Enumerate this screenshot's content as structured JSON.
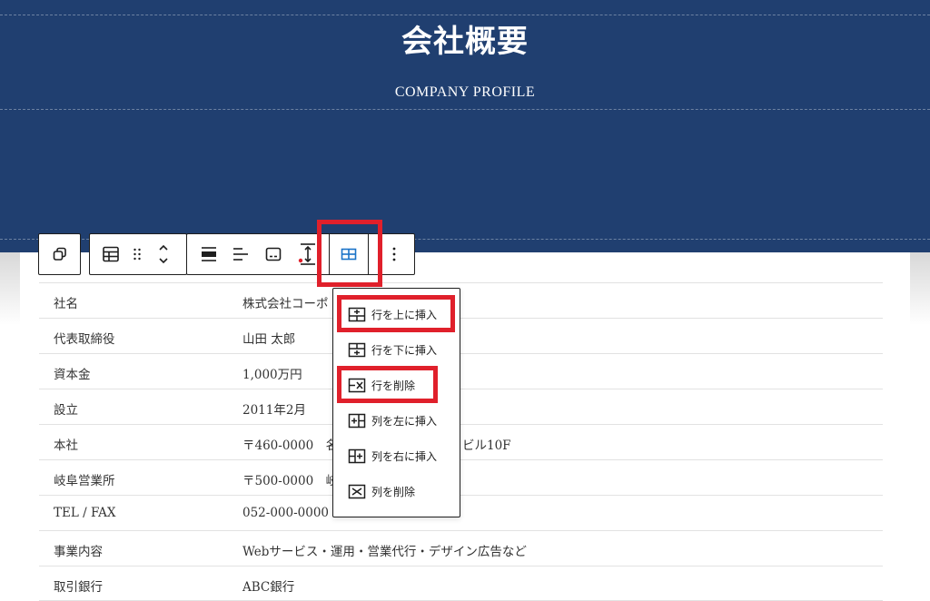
{
  "hero": {
    "title": "会社概要",
    "subtitle": "COMPANY PROFILE",
    "background_color": "#203f70"
  },
  "toolbar": {
    "buttons": [
      {
        "name": "block-transform",
        "icon": "duplicate-icon"
      },
      {
        "name": "table-block",
        "icon": "table-icon"
      },
      {
        "name": "drag-handle",
        "icon": "drag-handle-icon"
      },
      {
        "name": "move-up-down",
        "icon": "chevron-updown-icon"
      },
      {
        "name": "align",
        "icon": "align-full-icon"
      },
      {
        "name": "text-align",
        "icon": "align-left-icon"
      },
      {
        "name": "caption",
        "icon": "caption-icon"
      },
      {
        "name": "spacing",
        "icon": "vertical-spacing-icon"
      },
      {
        "name": "edit-table",
        "icon": "table-edit-icon",
        "active": true
      },
      {
        "name": "more-options",
        "icon": "more-vertical-icon"
      }
    ],
    "accent_color": "#e0202b"
  },
  "table": {
    "rows": [
      {
        "label": "社名",
        "value": "株式会社コーポ"
      },
      {
        "label": "代表取締役",
        "value": "山田 太郎"
      },
      {
        "label": "資本金",
        "value": "1,000万円"
      },
      {
        "label": "設立",
        "value": "2011年2月"
      },
      {
        "label": "本社",
        "value": "〒460-0000　名",
        "value_tail": "ビル10F"
      },
      {
        "label": "岐阜営業所",
        "value": "〒500-0000　岐"
      },
      {
        "label": "TEL / FAX",
        "value": "052-000-0000"
      },
      {
        "label": "事業内容",
        "value": "Webサービス・運用・営業代行・デザイン広告など"
      },
      {
        "label": "取引銀行",
        "value": "ABC銀行"
      }
    ]
  },
  "menu": {
    "items": [
      {
        "label": "行を上に挿入",
        "icon": "insert-row-above-icon",
        "highlighted": true
      },
      {
        "label": "行を下に挿入",
        "icon": "insert-row-below-icon"
      },
      {
        "label": "行を削除",
        "icon": "delete-row-icon",
        "highlighted": true
      },
      {
        "label": "列を左に挿入",
        "icon": "insert-column-left-icon"
      },
      {
        "label": "列を右に挿入",
        "icon": "insert-column-right-icon"
      },
      {
        "label": "列を削除",
        "icon": "delete-column-icon"
      }
    ]
  }
}
